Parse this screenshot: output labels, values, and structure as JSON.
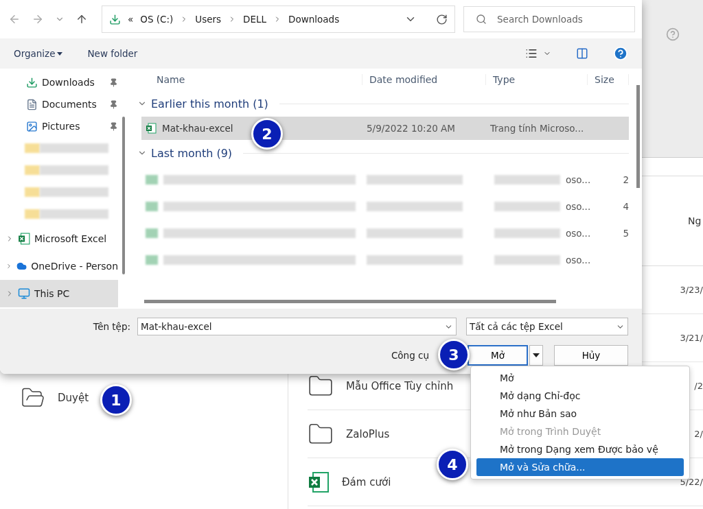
{
  "dialog": {
    "address": {
      "overflow": "«",
      "crumbs": [
        "OS (C:)",
        "Users",
        "DELL",
        "Downloads"
      ]
    },
    "search": {
      "placeholder": "Search Downloads"
    },
    "commands": {
      "organize": "Organize",
      "new_folder": "New folder"
    },
    "sidebar": [
      {
        "kind": "downloads",
        "label": "Downloads",
        "pinned": true,
        "expandable": false,
        "selected": false
      },
      {
        "kind": "documents",
        "label": "Documents",
        "pinned": true,
        "expandable": false,
        "selected": false
      },
      {
        "kind": "pictures",
        "label": "Pictures",
        "pinned": true,
        "expandable": false,
        "selected": false
      },
      {
        "kind": "blurred",
        "selected": false
      },
      {
        "kind": "blurred",
        "selected": false
      },
      {
        "kind": "blurred",
        "selected": false
      },
      {
        "kind": "blurred",
        "selected": false
      },
      {
        "kind": "excel",
        "label": "Microsoft Excel",
        "pinned": false,
        "expandable": true,
        "selected": false
      },
      {
        "kind": "onedrive",
        "label": "OneDrive - Person",
        "pinned": false,
        "expandable": true,
        "selected": false
      },
      {
        "kind": "pc",
        "label": "This PC",
        "pinned": false,
        "expandable": true,
        "selected": true
      }
    ],
    "columns": [
      "Name",
      "Date modified",
      "Type",
      "Size"
    ],
    "groups": [
      {
        "label": "Earlier this month (1)",
        "expanded": true,
        "files": [
          {
            "kind": "file",
            "name": "Mat-khau-excel",
            "date": "5/9/2022 10:20 AM",
            "type": "Trang tính Microso...",
            "selected": true
          }
        ]
      },
      {
        "label": "Last month (9)",
        "expanded": true,
        "files": [
          {
            "kind": "blurred",
            "type": "oso...",
            "size": "2",
            "selected": false
          },
          {
            "kind": "blurred",
            "type": "oso...",
            "size": "4",
            "selected": false
          },
          {
            "kind": "blurred",
            "type": "oso...",
            "size": "5",
            "selected": false
          },
          {
            "kind": "blurred",
            "type": "oso...",
            "selected": false
          }
        ]
      }
    ],
    "filename_label": "Tên tệp:",
    "filename": "Mat-khau-excel",
    "filter": "Tất cả các tệp Excel",
    "tools": "Công cụ",
    "open": "Mở",
    "cancel": "Hủy",
    "open_menu": [
      {
        "label": "Mở",
        "disabled": false,
        "selected": false
      },
      {
        "label": "Mở dạng Chỉ-đọc",
        "disabled": false,
        "selected": false
      },
      {
        "label": "Mở như Bản sao",
        "disabled": false,
        "selected": false
      },
      {
        "label": "Mở trong Trình Duyệt",
        "disabled": true,
        "selected": false
      },
      {
        "label": "Mở trong Dạng xem Được bảo vệ",
        "disabled": false,
        "selected": false
      },
      {
        "label": "Mở và Sửa chữa...",
        "disabled": false,
        "selected": true
      }
    ]
  },
  "backstage": {
    "browse": "Duyệt",
    "column_header": "Ng",
    "rows": [
      {
        "kind": "hidden",
        "date": "3/23/"
      },
      {
        "kind": "hidden",
        "date": "3/21/"
      },
      {
        "kind": "folder",
        "name": "Mẫu Office Tùy chỉnh",
        "date": "/2"
      },
      {
        "kind": "folder",
        "name": "ZaloPlus",
        "date": "2/"
      },
      {
        "kind": "excel",
        "name": "Đám cưới",
        "date": "5/22/"
      }
    ]
  },
  "step_badges": [
    "1",
    "2",
    "3",
    "4"
  ]
}
